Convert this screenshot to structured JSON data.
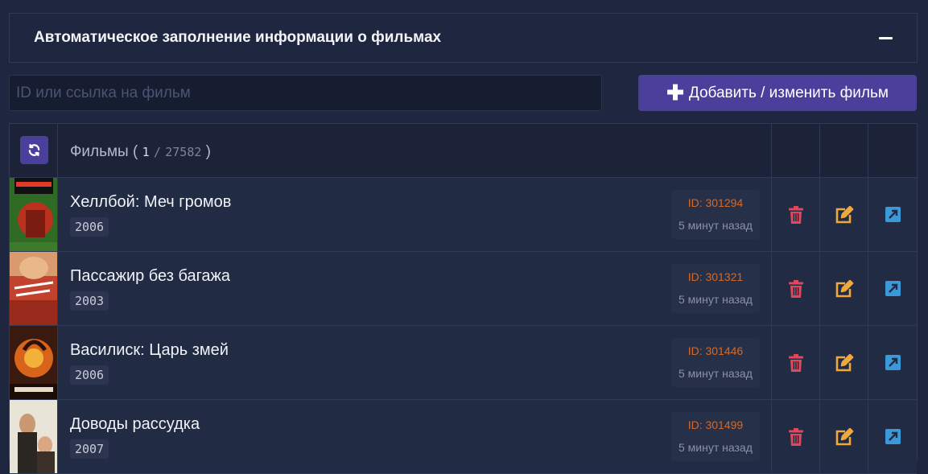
{
  "panel": {
    "title": "Автоматическое заполнение информации о фильмах"
  },
  "search": {
    "placeholder": "ID или ссылка на фильм",
    "value": ""
  },
  "add_button": {
    "label": "Добавить / изменить фильм"
  },
  "table": {
    "header": {
      "label": "Фильмы",
      "open_paren": "(",
      "current": "1",
      "separator": "/",
      "total": "27582",
      "close_paren": ")"
    },
    "rows": [
      {
        "title": "Хеллбой: Меч громов",
        "year": "2006",
        "id": "ID: 301294",
        "time": "5 минут назад"
      },
      {
        "title": "Пассажир без багажа",
        "year": "2003",
        "id": "ID: 301321",
        "time": "5 минут назад"
      },
      {
        "title": "Василиск: Царь змей",
        "year": "2006",
        "id": "ID: 301446",
        "time": "5 минут назад"
      },
      {
        "title": "Доводы рассудка",
        "year": "2007",
        "id": "ID: 301499",
        "time": "5 минут назад"
      }
    ]
  },
  "colors": {
    "accent": "#4b3f9c",
    "delete": "#e0485b",
    "edit": "#f0a83a",
    "open": "#3a9ad9",
    "id_text": "#cf6a2e"
  },
  "icons": {
    "collapse": "minus-icon",
    "add": "plus-icon",
    "refresh": "refresh-icon",
    "delete": "trash-icon",
    "edit": "edit-icon",
    "open": "external-link-icon"
  }
}
